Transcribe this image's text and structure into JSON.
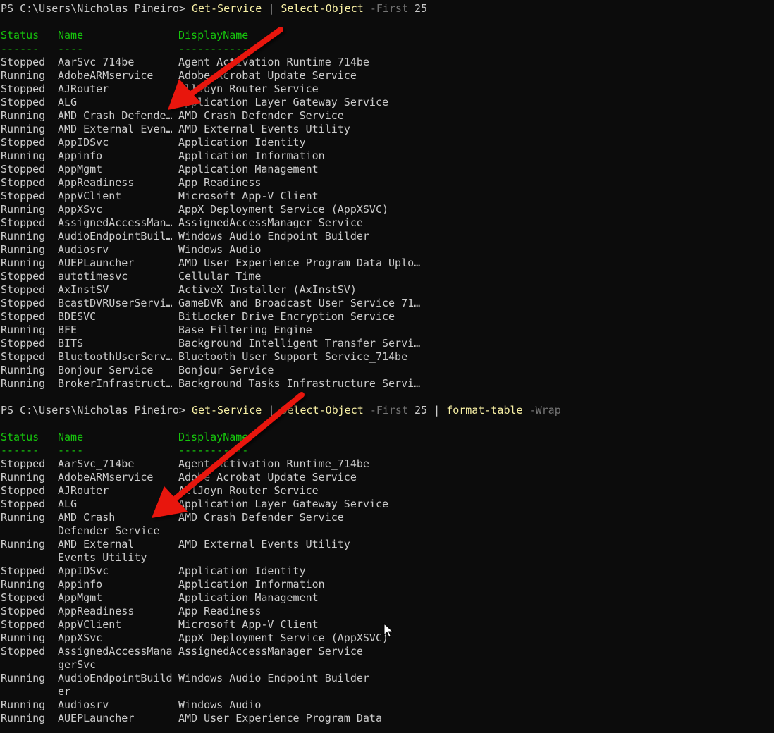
{
  "terminal": {
    "prompt": "PS C:\\Users\\Nicholas Pineiro>",
    "pipe": "|",
    "command1": {
      "cmdlet1": "Get-Service",
      "cmdlet2": "Select-Object",
      "param": "-First",
      "value": "25"
    },
    "command2": {
      "cmdlet1": "Get-Service",
      "cmdlet2": "Select-Object",
      "param": "-First",
      "value": "25",
      "cmdlet3": "format-table",
      "param2": "-Wrap"
    },
    "headers": {
      "status": "Status",
      "name": "Name",
      "display": "DisplayName"
    },
    "underline": {
      "status": "------",
      "name": "----",
      "display": "-----------"
    },
    "table1": [
      [
        "Stopped",
        "AarSvc_714be",
        "Agent Activation Runtime_714be"
      ],
      [
        "Running",
        "AdobeARMservice",
        "Adobe Acrobat Update Service"
      ],
      [
        "Stopped",
        "AJRouter",
        "AllJoyn Router Service"
      ],
      [
        "Stopped",
        "ALG",
        "Application Layer Gateway Service"
      ],
      [
        "Running",
        "AMD Crash Defende…",
        "AMD Crash Defender Service"
      ],
      [
        "Running",
        "AMD External Even…",
        "AMD External Events Utility"
      ],
      [
        "Stopped",
        "AppIDSvc",
        "Application Identity"
      ],
      [
        "Running",
        "Appinfo",
        "Application Information"
      ],
      [
        "Stopped",
        "AppMgmt",
        "Application Management"
      ],
      [
        "Stopped",
        "AppReadiness",
        "App Readiness"
      ],
      [
        "Stopped",
        "AppVClient",
        "Microsoft App-V Client"
      ],
      [
        "Running",
        "AppXSvc",
        "AppX Deployment Service (AppXSVC)"
      ],
      [
        "Stopped",
        "AssignedAccessMan…",
        "AssignedAccessManager Service"
      ],
      [
        "Running",
        "AudioEndpointBuil…",
        "Windows Audio Endpoint Builder"
      ],
      [
        "Running",
        "Audiosrv",
        "Windows Audio"
      ],
      [
        "Running",
        "AUEPLauncher",
        "AMD User Experience Program Data Uplo…"
      ],
      [
        "Stopped",
        "autotimesvc",
        "Cellular Time"
      ],
      [
        "Stopped",
        "AxInstSV",
        "ActiveX Installer (AxInstSV)"
      ],
      [
        "Stopped",
        "BcastDVRUserServi…",
        "GameDVR and Broadcast User Service_71…"
      ],
      [
        "Stopped",
        "BDESVC",
        "BitLocker Drive Encryption Service"
      ],
      [
        "Running",
        "BFE",
        "Base Filtering Engine"
      ],
      [
        "Stopped",
        "BITS",
        "Background Intelligent Transfer Servi…"
      ],
      [
        "Stopped",
        "BluetoothUserServ…",
        "Bluetooth User Support Service_714be"
      ],
      [
        "Running",
        "Bonjour Service",
        "Bonjour Service"
      ],
      [
        "Running",
        "BrokerInfrastruct…",
        "Background Tasks Infrastructure Servi…"
      ]
    ],
    "table2": [
      [
        "Stopped",
        "AarSvc_714be",
        "Agent Activation Runtime_714be"
      ],
      [
        "Running",
        "AdobeARMservice",
        "Adobe Acrobat Update Service"
      ],
      [
        "Stopped",
        "AJRouter",
        "AllJoyn Router Service"
      ],
      [
        "Stopped",
        "ALG",
        "Application Layer Gateway Service"
      ],
      [
        "Running",
        "AMD Crash",
        "AMD Crash Defender Service"
      ],
      [
        "",
        "Defender Service",
        ""
      ],
      [
        "Running",
        "AMD External",
        "AMD External Events Utility"
      ],
      [
        "",
        "Events Utility",
        ""
      ],
      [
        "Stopped",
        "AppIDSvc",
        "Application Identity"
      ],
      [
        "Running",
        "Appinfo",
        "Application Information"
      ],
      [
        "Stopped",
        "AppMgmt",
        "Application Management"
      ],
      [
        "Stopped",
        "AppReadiness",
        "App Readiness"
      ],
      [
        "Stopped",
        "AppVClient",
        "Microsoft App-V Client"
      ],
      [
        "Running",
        "AppXSvc",
        "AppX Deployment Service (AppXSVC)"
      ],
      [
        "Stopped",
        "AssignedAccessMana",
        "AssignedAccessManager Service"
      ],
      [
        "",
        "gerSvc",
        ""
      ],
      [
        "Running",
        "AudioEndpointBuild",
        "Windows Audio Endpoint Builder"
      ],
      [
        "",
        "er",
        ""
      ],
      [
        "Running",
        "Audiosrv",
        "Windows Audio"
      ],
      [
        "Running",
        "AUEPLauncher",
        "AMD User Experience Program Data"
      ]
    ]
  },
  "colors": {
    "background": "#0c0c0c",
    "text": "#cccccc",
    "header": "#16c60c",
    "command": "#f9f1a5",
    "parameter": "#767676",
    "arrow": "#e8120c"
  }
}
